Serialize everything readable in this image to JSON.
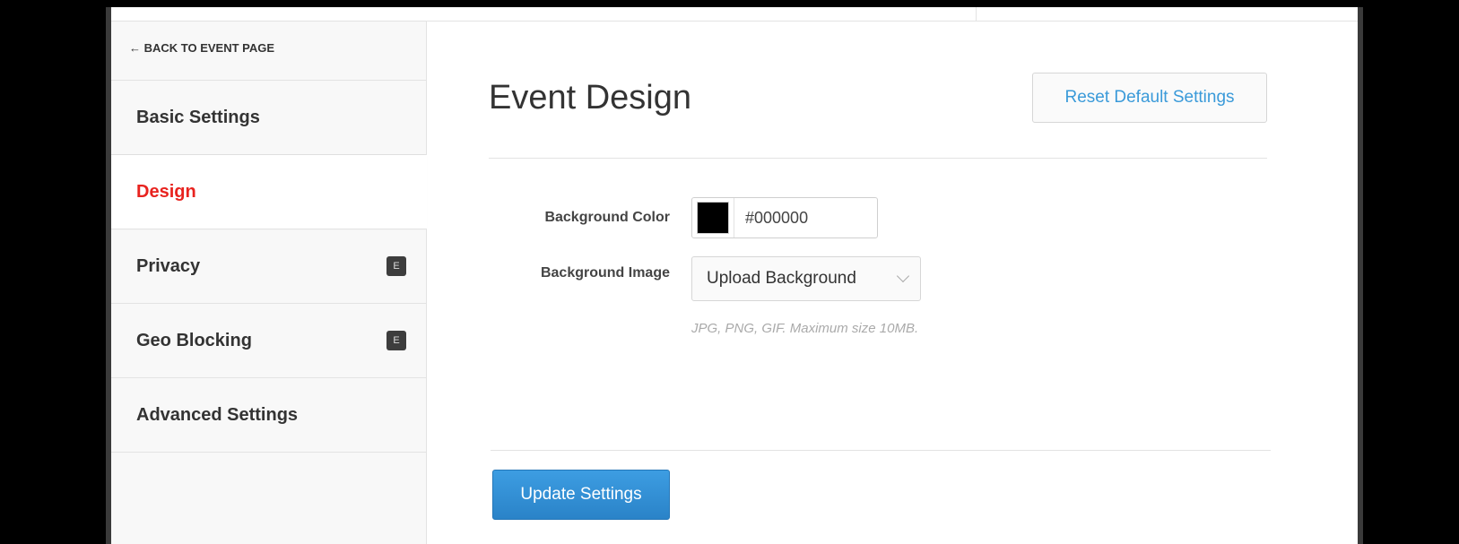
{
  "sidebar": {
    "back_link": "← BACK TO EVENT PAGE",
    "items": [
      {
        "label": "Basic Settings",
        "badge": ""
      },
      {
        "label": "Design",
        "badge": ""
      },
      {
        "label": "Privacy",
        "badge": "E"
      },
      {
        "label": "Geo Blocking",
        "badge": "E"
      },
      {
        "label": "Advanced Settings",
        "badge": ""
      }
    ],
    "active_item": "Design"
  },
  "main": {
    "title": "Event Design",
    "reset_button": "Reset Default Settings",
    "background_color": {
      "label": "Background Color",
      "value": "#000000",
      "swatch": "#000000"
    },
    "background_image": {
      "label": "Background Image",
      "select_value": "Upload Background",
      "hint": "JPG, PNG, GIF. Maximum size 10MB."
    },
    "update_button": "Update Settings"
  },
  "colors": {
    "active_nav": "#e8231f",
    "link_blue": "#3a9ad9",
    "primary_button": "#2a83c8"
  }
}
